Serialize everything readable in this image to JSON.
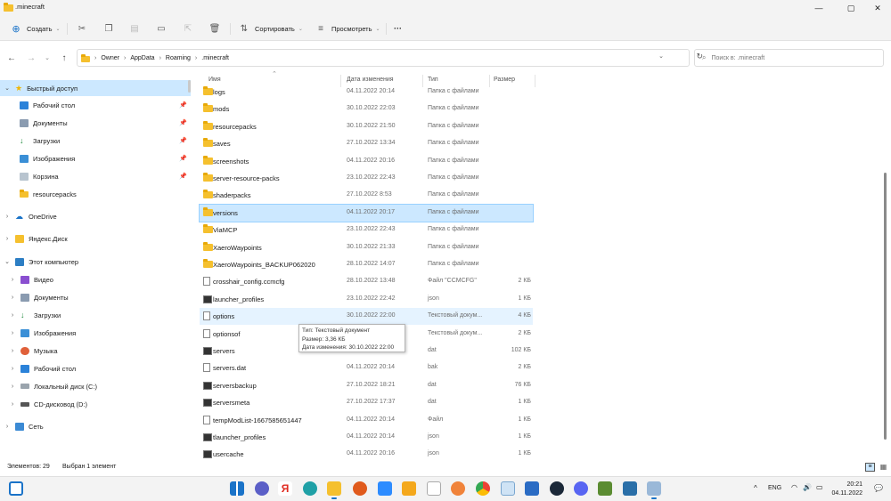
{
  "window": {
    "title": ".minecraft",
    "controls": {
      "minimize": "—",
      "maximize": "▢",
      "close": "✕"
    }
  },
  "toolbar": {
    "create_label": "Создать",
    "sort_label": "Сортировать",
    "view_label": "Просмотреть",
    "more_label": "···"
  },
  "address": {
    "segments": [
      "Owner",
      "AppData",
      "Roaming",
      ".minecraft"
    ],
    "search_placeholder": "Поиск в: .minecraft"
  },
  "sidebar": {
    "quick_access": "Быстрый доступ",
    "pinned": [
      "Рабочий стол",
      "Документы",
      "Загрузки",
      "Изображения",
      "Корзина",
      "resourcepacks"
    ],
    "onedrive": "OneDrive",
    "yandex": "Яндекс.Диск",
    "this_pc": "Этот компьютер",
    "pc_items": [
      "Видео",
      "Документы",
      "Загрузки",
      "Изображения",
      "Музыка",
      "Рабочий стол",
      "Локальный диск (C:)",
      "CD-дисковод (D:)"
    ],
    "network": "Сеть"
  },
  "columns": {
    "name": "Имя",
    "date": "Дата изменения",
    "type": "Тип",
    "size": "Размер"
  },
  "files": [
    {
      "name": "logs",
      "date": "04.11.2022 20:14",
      "type": "Папка с файлами",
      "size": "",
      "icon": "folder"
    },
    {
      "name": "mods",
      "date": "30.10.2022 22:03",
      "type": "Папка с файлами",
      "size": "",
      "icon": "folder"
    },
    {
      "name": "resourcepacks",
      "date": "30.10.2022 21:50",
      "type": "Папка с файлами",
      "size": "",
      "icon": "folder"
    },
    {
      "name": "saves",
      "date": "27.10.2022 13:34",
      "type": "Папка с файлами",
      "size": "",
      "icon": "folder"
    },
    {
      "name": "screenshots",
      "date": "04.11.2022 20:16",
      "type": "Папка с файлами",
      "size": "",
      "icon": "folder"
    },
    {
      "name": "server-resource-packs",
      "date": "23.10.2022 22:43",
      "type": "Папка с файлами",
      "size": "",
      "icon": "folder"
    },
    {
      "name": "shaderpacks",
      "date": "27.10.2022 8:53",
      "type": "Папка с файлами",
      "size": "",
      "icon": "folder"
    },
    {
      "name": "versions",
      "date": "04.11.2022 20:17",
      "type": "Папка с файлами",
      "size": "",
      "icon": "folder"
    },
    {
      "name": "ViaMCP",
      "date": "23.10.2022 22:43",
      "type": "Папка с файлами",
      "size": "",
      "icon": "folder"
    },
    {
      "name": "XaeroWaypoints",
      "date": "30.10.2022 21:33",
      "type": "Папка с файлами",
      "size": "",
      "icon": "folder"
    },
    {
      "name": "XaeroWaypoints_BACKUP062020",
      "date": "28.10.2022 14:07",
      "type": "Папка с файлами",
      "size": "",
      "icon": "folder"
    },
    {
      "name": "crosshair_config.ccmcfg",
      "date": "28.10.2022 13:48",
      "type": "Файл \"CCMCFG\"",
      "size": "2 КБ",
      "icon": "doc"
    },
    {
      "name": "launcher_profiles",
      "date": "23.10.2022 22:42",
      "type": "json",
      "size": "1 КБ",
      "icon": "bin"
    },
    {
      "name": "options",
      "date": "30.10.2022 22:00",
      "type": "Текстовый докум...",
      "size": "4 КБ",
      "icon": "doc"
    },
    {
      "name": "optionsof",
      "date": "",
      "type": "Текстовый докум...",
      "size": "2 КБ",
      "icon": "doc"
    },
    {
      "name": "servers",
      "date": "",
      "type": "dat",
      "size": "102 КБ",
      "icon": "bin"
    },
    {
      "name": "servers.dat",
      "date": "04.11.2022 20:14",
      "type": "bak",
      "size": "2 КБ",
      "icon": "doc"
    },
    {
      "name": "serversbackup",
      "date": "27.10.2022 18:21",
      "type": "dat",
      "size": "76 КБ",
      "icon": "bin"
    },
    {
      "name": "serversmeta",
      "date": "27.10.2022 17:37",
      "type": "dat",
      "size": "1 КБ",
      "icon": "bin"
    },
    {
      "name": "tempModList-1667585651447",
      "date": "04.11.2022 20:14",
      "type": "Файл",
      "size": "1 КБ",
      "icon": "doc"
    },
    {
      "name": "tlauncher_profiles",
      "date": "04.11.2022 20:14",
      "type": "json",
      "size": "1 КБ",
      "icon": "bin"
    },
    {
      "name": "usercache",
      "date": "04.11.2022 20:16",
      "type": "json",
      "size": "1 КБ",
      "icon": "bin"
    }
  ],
  "tooltip": {
    "line1": "Тип: Текстовый документ",
    "line2": "Размер: 3,36 КБ",
    "line3": "Дата изменения: 30.10.2022 22:00"
  },
  "status": {
    "count": "Элементов: 29",
    "selected": "Выбран 1 элемент"
  },
  "taskbar": {
    "lang": "ENG",
    "time": "20:21",
    "date": "04.11.2022",
    "tray_up": "^"
  },
  "colors": {
    "folder": "#f5c02e",
    "selection": "#cce8ff",
    "accent": "#1a73c8"
  }
}
